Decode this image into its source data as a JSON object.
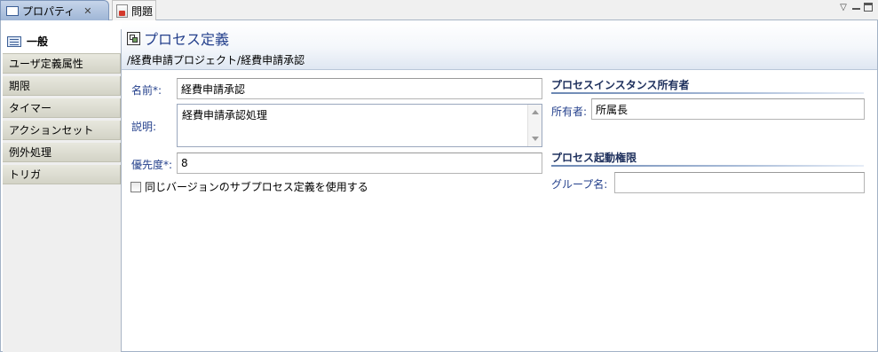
{
  "tabs": {
    "properties_label": "プロパティ",
    "problems_label": "問題"
  },
  "side_tabs": [
    {
      "label": "一般"
    },
    {
      "label": "ユーザ定義属性"
    },
    {
      "label": "期限"
    },
    {
      "label": "タイマー"
    },
    {
      "label": "アクションセット"
    },
    {
      "label": "例外処理"
    },
    {
      "label": "トリガ"
    }
  ],
  "header": {
    "title": "プロセス定義",
    "path": "/経費申請プロジェクト/経費申請承認"
  },
  "form": {
    "name_label": "名前*:",
    "name_value": "経費申請承認",
    "description_label": "説明:",
    "description_value": "経費申請承認処理",
    "priority_label": "優先度*:",
    "priority_value": "8",
    "same_version_label": "同じバージョンのサブプロセス定義を使用する",
    "same_version_checked": false
  },
  "owner_section": {
    "title": "プロセスインスタンス所有者",
    "owner_label": "所有者:",
    "owner_value": "所属長"
  },
  "start_section": {
    "title": "プロセス起動権限",
    "group_label": "グループ名:",
    "group_value": ""
  },
  "colors": {
    "label_blue": "#24408c",
    "header_title": "#24408c",
    "tab_active": "#9fb6d6"
  }
}
